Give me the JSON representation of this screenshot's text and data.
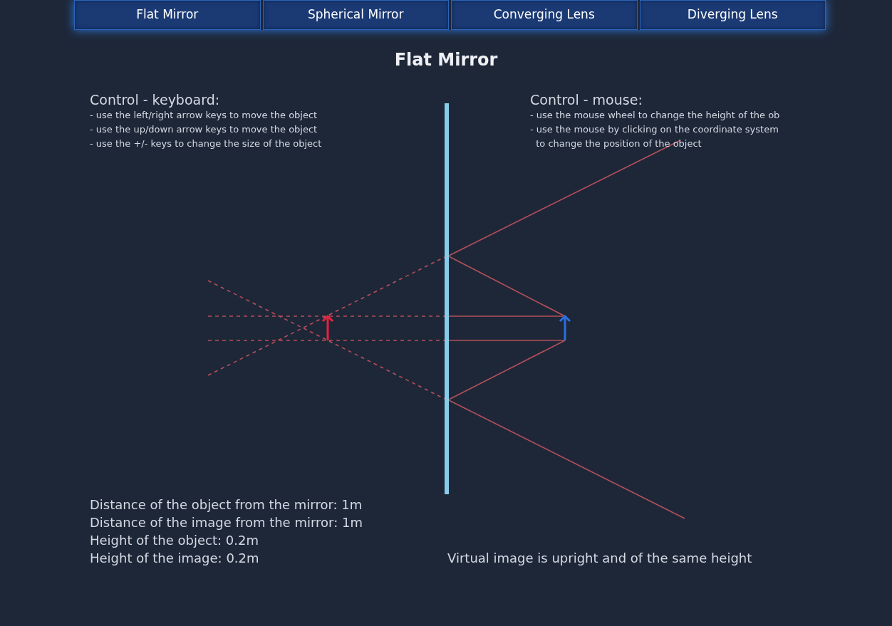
{
  "tabs": [
    {
      "label": "Flat Mirror"
    },
    {
      "label": "Spherical Mirror"
    },
    {
      "label": "Converging Lens"
    },
    {
      "label": "Diverging Lens"
    }
  ],
  "title": "Flat Mirror",
  "controls": [
    {
      "heading": "Control - keyboard:",
      "lines": [
        "- use the left/right arrow keys to move the object",
        "- use the up/down arrow keys to move the object",
        "- use the +/- keys to change the size of the object"
      ]
    },
    {
      "heading": "Control - mouse:",
      "lines": [
        "- use the mouse wheel to change the height of the ob",
        "- use the mouse by clicking on the coordinate system",
        "  to change the position of the object"
      ]
    }
  ],
  "measurements": [
    "Distance of the object from the mirror: 1m",
    "Distance of the image from the mirror: 1m",
    "Height of the object: 0.2m",
    "Height of the image: 0.2m"
  ],
  "conclusion": "Virtual image is upright and of the same height"
}
